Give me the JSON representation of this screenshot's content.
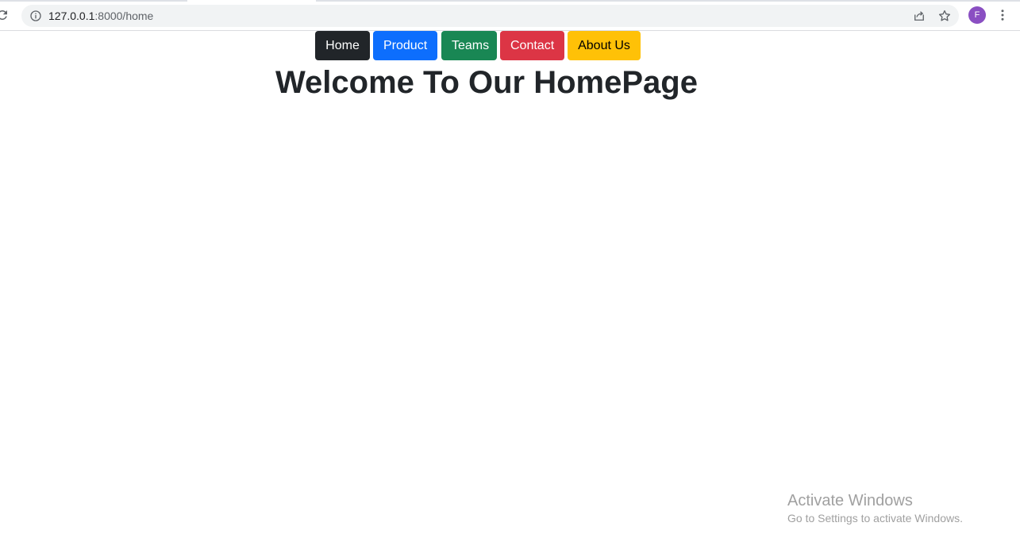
{
  "browser": {
    "url_host": "127.0.0.1",
    "url_path": ":8000/home",
    "profile_initial": "F",
    "profile_color": "#8a4fc2"
  },
  "nav": {
    "home": "Home",
    "product": "Product",
    "teams": "Teams",
    "contact": "Contact",
    "about": "About Us"
  },
  "page": {
    "title": "Welcome To Our HomePage"
  },
  "watermark": {
    "title": "Activate Windows",
    "subtitle": "Go to Settings to activate Windows."
  },
  "colors": {
    "home": "#212529",
    "product": "#0d6efd",
    "teams": "#198754",
    "contact": "#dc3545",
    "about": "#ffc107"
  }
}
